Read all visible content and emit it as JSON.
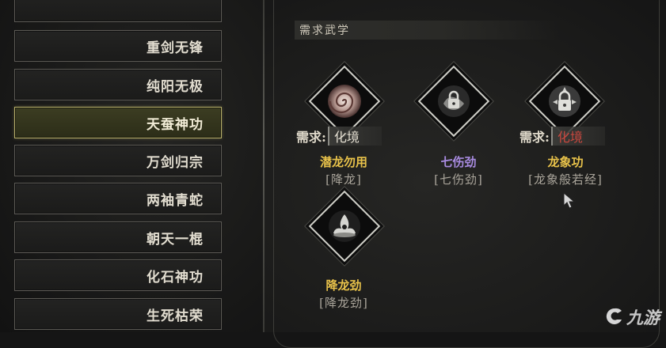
{
  "sidebar": {
    "items": [
      {
        "label": "",
        "state": "partial"
      },
      {
        "label": "重剑无锋",
        "state": "normal"
      },
      {
        "label": "纯阳无极",
        "state": "normal"
      },
      {
        "label": "天蚕神功",
        "state": "active"
      },
      {
        "label": "万剑归宗",
        "state": "normal"
      },
      {
        "label": "两袖青蛇",
        "state": "normal"
      },
      {
        "label": "朝天一棍",
        "state": "normal"
      },
      {
        "label": "化石神功",
        "state": "normal"
      },
      {
        "label": "生死枯荣",
        "state": "normal"
      }
    ]
  },
  "panel": {
    "section_title": "需求武学",
    "skills": [
      {
        "name": "潜龙勿用",
        "sub": "[降龙]",
        "req_label": "需求:",
        "req_value": "化境",
        "req_met": true,
        "name_color": "#e8c24a",
        "icon": "swirl-vortex-icon"
      },
      {
        "name": "七伤劲",
        "sub": "[七伤劲]",
        "req_label": "",
        "req_value": "",
        "req_met": true,
        "name_color": "#a88be0",
        "icon": "locked-fist-icon"
      },
      {
        "name": "龙象功",
        "sub": "[龙象般若经]",
        "req_label": "需求:",
        "req_value": "化境",
        "req_met": false,
        "name_color": "#e8c24a",
        "icon": "locked-figure-icon"
      },
      {
        "name": "降龙劲",
        "sub": "[降龙劲]",
        "req_label": "",
        "req_value": "",
        "req_met": true,
        "name_color": "#e8c24a",
        "icon": "dragon-aura-icon"
      }
    ]
  },
  "colors": {
    "active_border": "#b8b06a",
    "gold_name": "#e8c24a",
    "purple_name": "#a88be0",
    "unmet_red": "#c9483f"
  },
  "watermark": {
    "text": "九游"
  }
}
